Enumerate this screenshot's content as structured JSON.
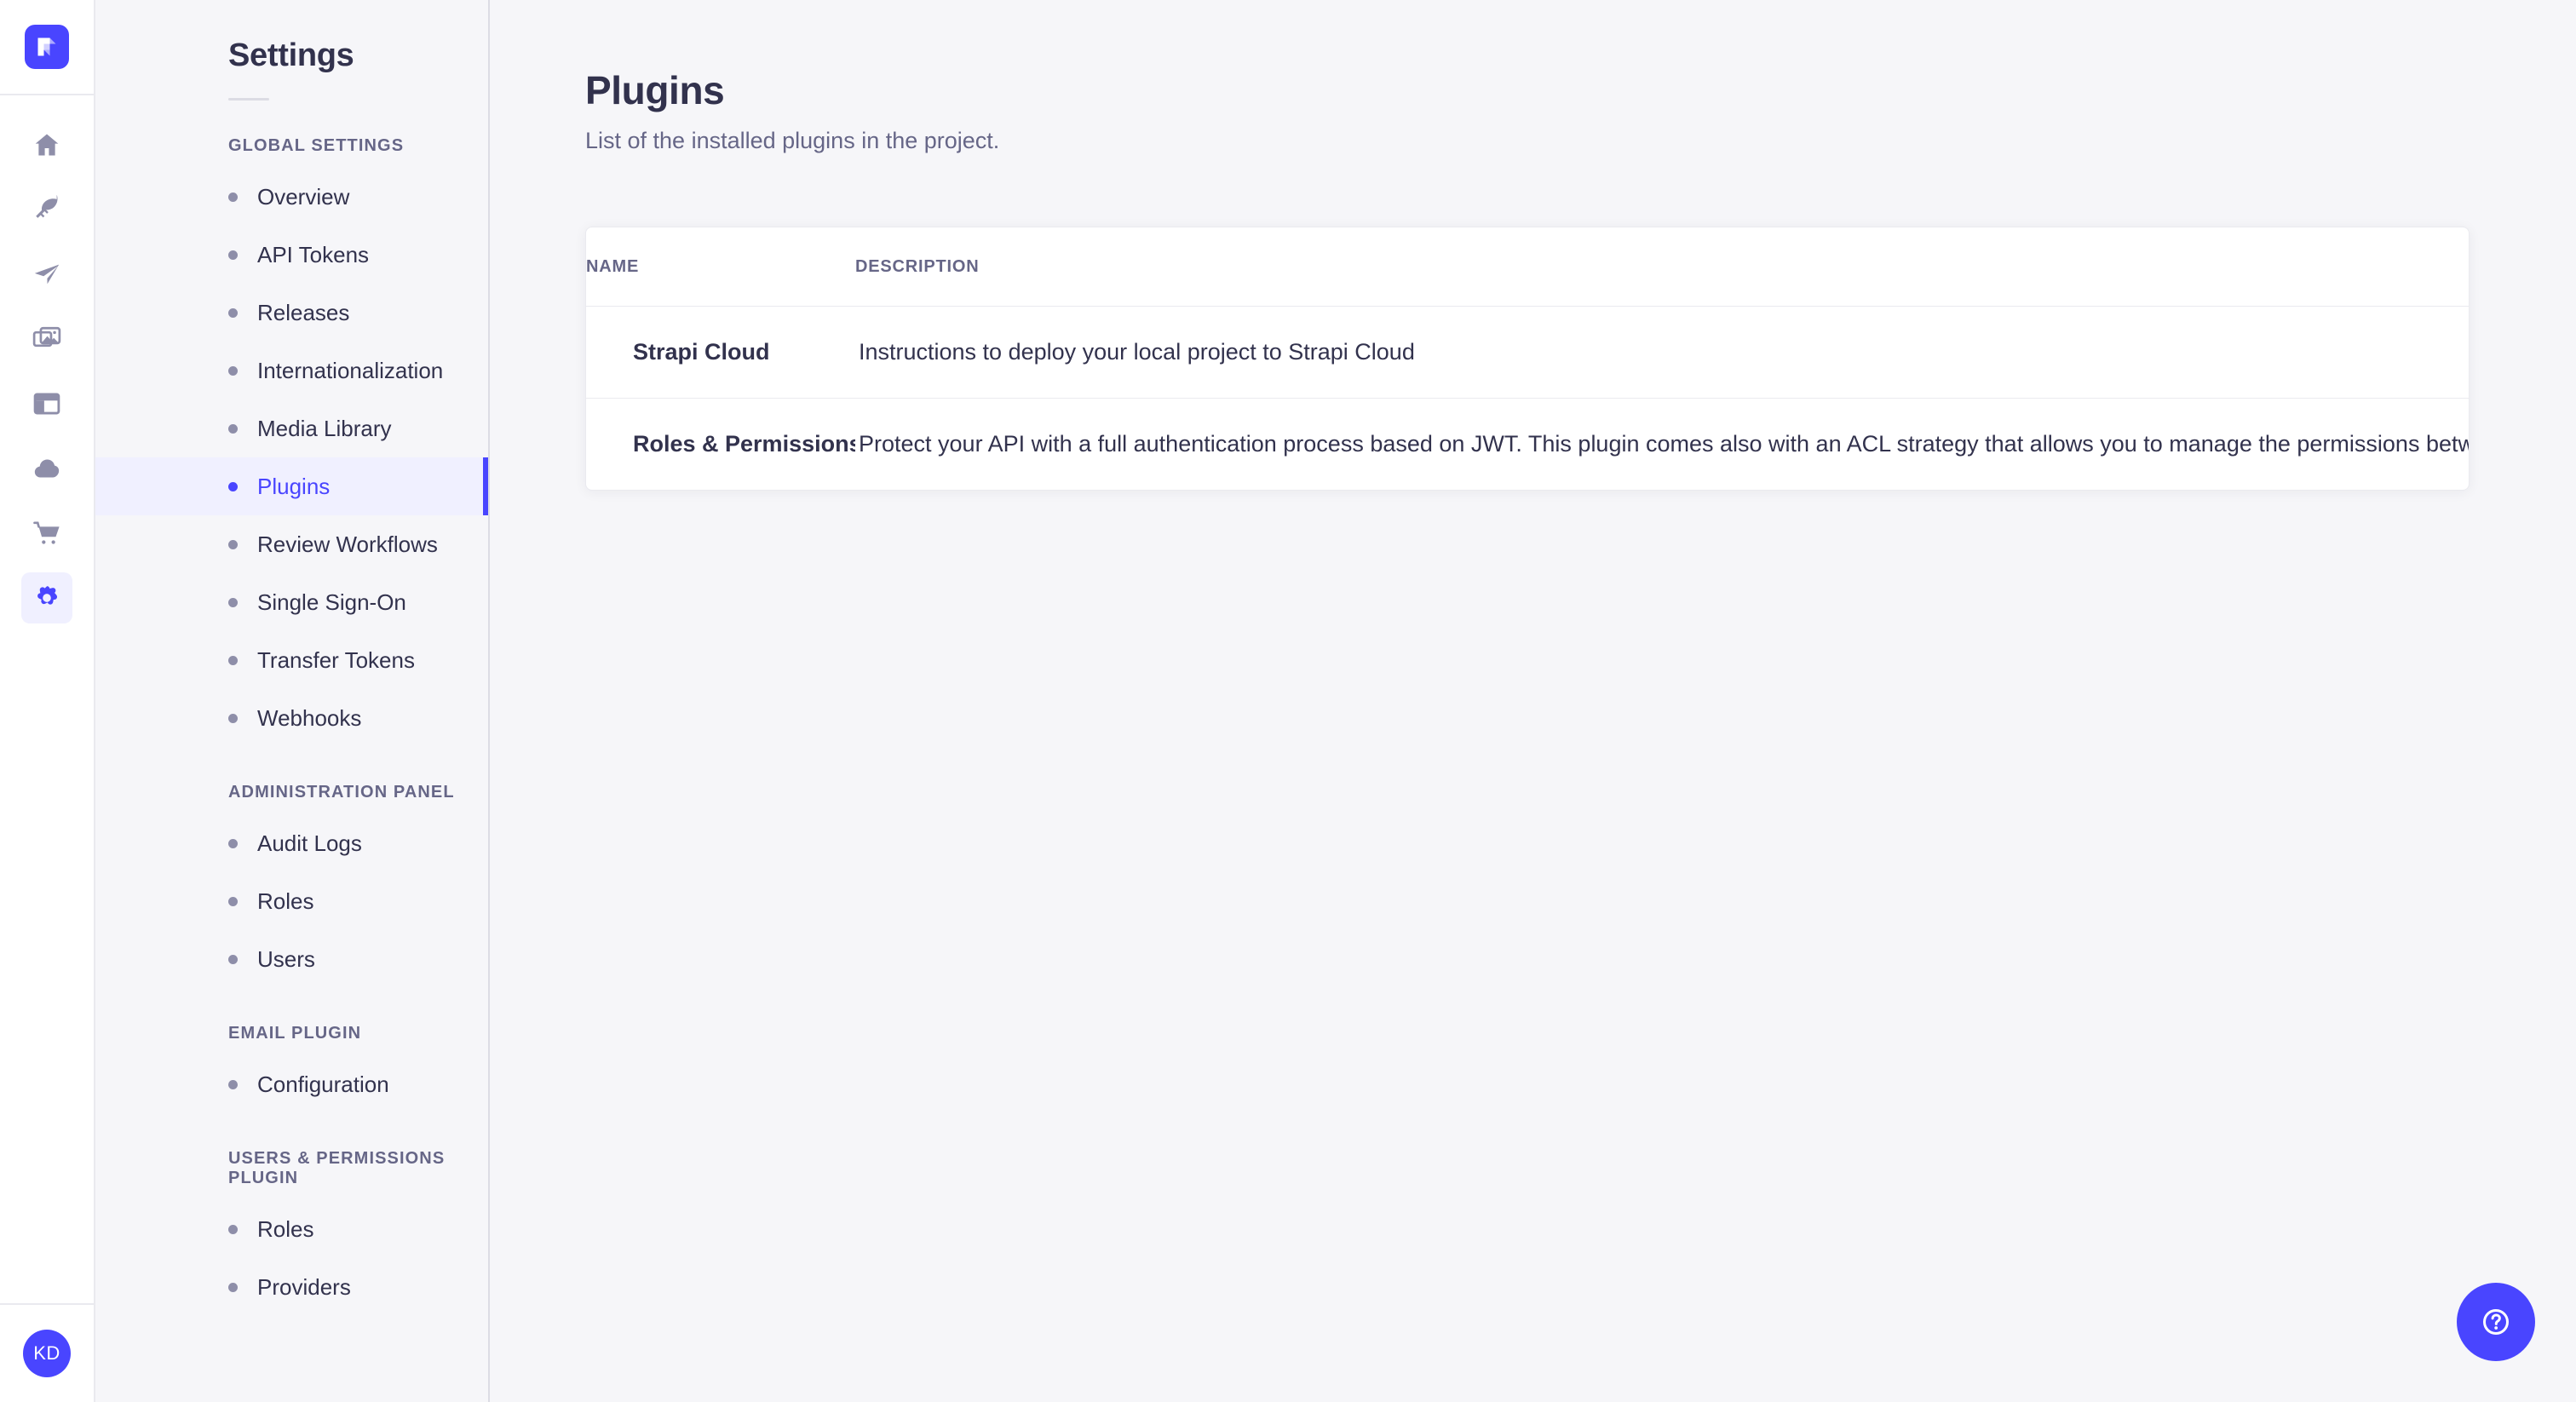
{
  "brand": {
    "logo_icon": "strapi-logo-icon",
    "accent_color": "#4945ff"
  },
  "icon_rail": {
    "items": [
      {
        "icon": "home-icon",
        "name": "home"
      },
      {
        "icon": "feather-icon",
        "name": "content-manager"
      },
      {
        "icon": "paper-plane-icon",
        "name": "releases"
      },
      {
        "icon": "images-icon",
        "name": "media-library"
      },
      {
        "icon": "layout-icon",
        "name": "content-type-builder"
      },
      {
        "icon": "cloud-icon",
        "name": "strapi-cloud"
      },
      {
        "icon": "shopping-cart-icon",
        "name": "marketplace"
      },
      {
        "icon": "gear-icon",
        "name": "settings"
      }
    ],
    "active_index": 7,
    "avatar": {
      "initials": "KD",
      "background": "#4945ff"
    }
  },
  "sidebar": {
    "title": "Settings",
    "sections": [
      {
        "title": "GLOBAL SETTINGS",
        "items": [
          {
            "label": "Overview",
            "active": false
          },
          {
            "label": "API Tokens",
            "active": false
          },
          {
            "label": "Releases",
            "active": false
          },
          {
            "label": "Internationalization",
            "active": false
          },
          {
            "label": "Media Library",
            "active": false
          },
          {
            "label": "Plugins",
            "active": true
          },
          {
            "label": "Review Workflows",
            "active": false
          },
          {
            "label": "Single Sign-On",
            "active": false
          },
          {
            "label": "Transfer Tokens",
            "active": false
          },
          {
            "label": "Webhooks",
            "active": false
          }
        ]
      },
      {
        "title": "ADMINISTRATION PANEL",
        "items": [
          {
            "label": "Audit Logs",
            "active": false
          },
          {
            "label": "Roles",
            "active": false
          },
          {
            "label": "Users",
            "active": false
          }
        ]
      },
      {
        "title": "EMAIL PLUGIN",
        "items": [
          {
            "label": "Configuration",
            "active": false
          }
        ]
      },
      {
        "title": "USERS & PERMISSIONS PLUGIN",
        "items": [
          {
            "label": "Roles",
            "active": false
          },
          {
            "label": "Providers",
            "active": false
          }
        ]
      }
    ]
  },
  "main": {
    "title": "Plugins",
    "subtitle": "List of the installed plugins in the project.",
    "table": {
      "columns": [
        "NAME",
        "DESCRIPTION"
      ],
      "rows": [
        {
          "name": "Strapi Cloud",
          "description": "Instructions to deploy your local project to Strapi Cloud"
        },
        {
          "name": "Roles & Permissions",
          "description": "Protect your API with a full authentication process based on JWT. This plugin comes also with an ACL strategy that allows you to manage the permissions between the groups of users."
        }
      ]
    }
  },
  "help": {
    "icon": "question-mark-circle-icon",
    "label": "Help",
    "background": "#4945ff"
  }
}
